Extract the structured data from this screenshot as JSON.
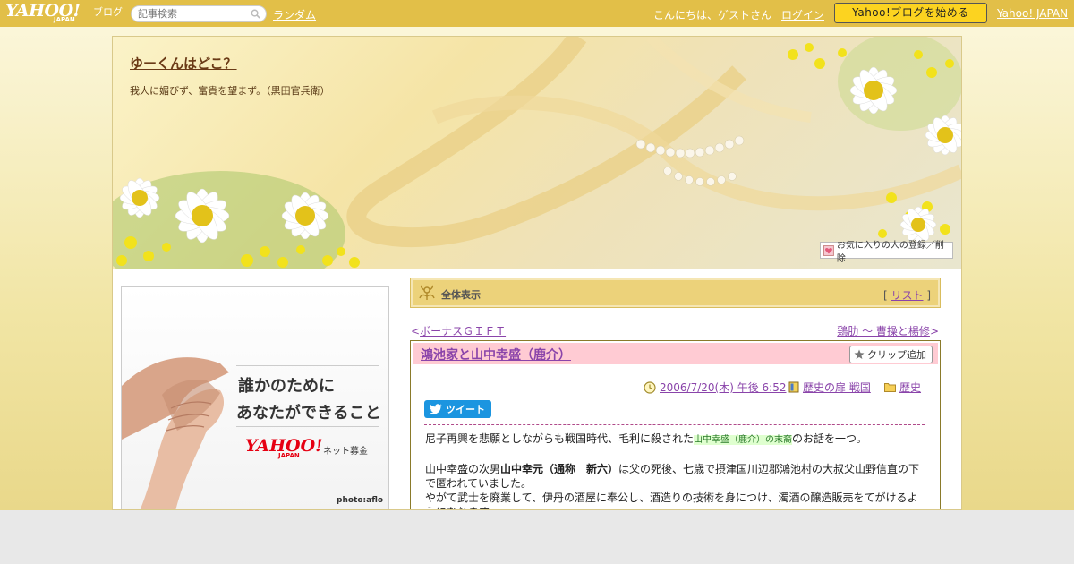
{
  "topbar": {
    "logo_main": "YAHOO!",
    "logo_japan": "JAPAN",
    "logo_blog": "ブログ",
    "search_placeholder": "記事検索",
    "random_link": "ランダム",
    "greeting": "こんにちは、ゲストさん",
    "login_link": "ログイン",
    "start_button": "Yahoo!ブログを始める",
    "yahoo_japan_link": "Yahoo! JAPAN"
  },
  "banner": {
    "blog_title": "ゆーくんはどこ？",
    "blog_subtitle": "我人に媚びず、富貴を望まず。（黒田官兵衛）",
    "favorite_button": "お気に入りの人の登録／削除"
  },
  "ad": {
    "line1": "誰かのために",
    "line2": "あなたができること",
    "brand": "YAHOO!",
    "brand_japan": "JAPAN",
    "service": "ネット募金",
    "credit": "photo:aflo"
  },
  "view_bar": {
    "label": "全体表示",
    "list_open": "[ ",
    "list_link": "リスト",
    "list_close": " ]"
  },
  "nav": {
    "prev_arrow": "<",
    "prev_label": "ボーナスＧＩＦＴ",
    "next_label": "鶏肋 ～ 曹操と楊修",
    "next_arrow": ">"
  },
  "article": {
    "title": "鴻池家と山中幸盛（鹿介）",
    "clip_button": "クリップ追加",
    "date": "2006/7/20(木) 午後 6:52",
    "category_label": "歴史の扉 戦国",
    "folder_label": "歴史",
    "tweet_button": "ツイート",
    "p1_before": "尼子再興を悲願としながらも戦国時代、毛利に殺された",
    "p1_highlight": "山中幸盛（鹿介）の末裔",
    "p1_after": "のお話を一つ。",
    "p2_before": "山中幸盛の次男",
    "p2_bold": "山中幸元（通称　新六）",
    "p2_after": "は父の死後、七歳で摂津国川辺郡鴻池村の大叔父山野信直の下で匿われていました。",
    "p3": "やがて武士を廃業して、伊丹の酒屋に奉公し、酒造りの技術を身につけ、濁酒の醸造販売をてがけるようになります。"
  },
  "colors": {
    "topbar": "#e2bf48",
    "start_button": "#fcd320",
    "link": "#8a44aa",
    "article_header": "#ffcbd3",
    "view_bar": "#ecd27a"
  }
}
